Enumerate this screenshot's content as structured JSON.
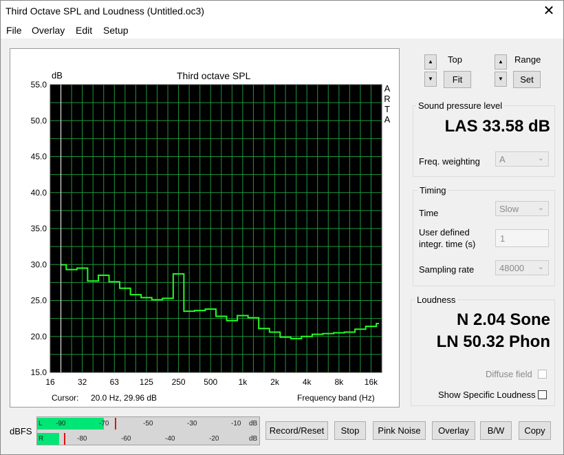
{
  "window": {
    "title": "Third Octave SPL and Loudness (Untitled.oc3)",
    "close": "✕"
  },
  "menu": [
    "File",
    "Overlay",
    "Edit",
    "Setup"
  ],
  "chart_data": {
    "type": "line",
    "title": "Third octave SPL",
    "ylabel": "dB",
    "xlabel": "Frequency band (Hz)",
    "ylim": [
      15.0,
      55.0
    ],
    "yticks": [
      "55.0",
      "50.0",
      "45.0",
      "40.0",
      "35.0",
      "30.0",
      "25.0",
      "20.0",
      "15.0"
    ],
    "xticks": [
      "16",
      "32",
      "63",
      "125",
      "250",
      "500",
      "1k",
      "2k",
      "4k",
      "8k",
      "16k"
    ],
    "bands": [
      "20",
      "25",
      "31.5",
      "40",
      "50",
      "63",
      "80",
      "100",
      "125",
      "160",
      "200",
      "250",
      "315",
      "400",
      "500",
      "630",
      "800",
      "1k",
      "1.25k",
      "1.6k",
      "2k",
      "2.5k",
      "3.15k",
      "4k",
      "5k",
      "6.3k",
      "8k",
      "10k",
      "12.5k",
      "16k",
      "20k"
    ],
    "values": [
      29.96,
      29.3,
      29.5,
      27.7,
      28.5,
      27.6,
      26.7,
      25.8,
      25.4,
      25.1,
      25.3,
      28.7,
      23.5,
      23.6,
      23.8,
      22.8,
      22.2,
      22.9,
      22.6,
      21.1,
      20.6,
      19.9,
      19.7,
      20.0,
      20.3,
      20.4,
      20.5,
      20.6,
      21.0,
      21.4,
      21.8
    ],
    "side_label": [
      "A",
      "R",
      "T",
      "A"
    ],
    "grid": true,
    "cursor": {
      "label": "Cursor:",
      "value": "20.0 Hz, 29.96 dB"
    }
  },
  "controls": {
    "top_label": "Top",
    "fit_label": "Fit",
    "range_label": "Range",
    "set_label": "Set",
    "spin_up": "▲",
    "spin_down": "▼"
  },
  "spl": {
    "group_label": "Sound pressure level",
    "value": "LAS 33.58 dB",
    "freq_weighting_label": "Freq. weighting",
    "freq_weighting_value": "A"
  },
  "timing": {
    "group_label": "Timing",
    "time_label": "Time",
    "time_value": "Slow",
    "user_time_label_1": "User defined",
    "user_time_label_2": "integr. time (s)",
    "user_time_value": "1",
    "sampling_label": "Sampling rate",
    "sampling_value": "48000"
  },
  "loudness": {
    "group_label": "Loudness",
    "sone": "N 2.04 Sone",
    "phon": "LN 50.32 Phon",
    "diffuse_label": "Diffuse field",
    "specific_label": "Show Specific Loudness"
  },
  "meter": {
    "label": "dBFS",
    "left_channel": "L",
    "right_channel": "R",
    "top_scale": [
      "-90",
      "-70",
      "-50",
      "-30",
      "-10",
      "dB"
    ],
    "bottom_scale": [
      "-80",
      "-60",
      "-40",
      "-20",
      "dB"
    ],
    "left_level_db": -70,
    "right_level_db": -90,
    "left_peak_db": -65,
    "right_peak_db": -88,
    "color_level": "#00e676",
    "color_peak": "#e01010"
  },
  "buttons": {
    "record_reset": "Record/Reset",
    "stop": "Stop",
    "pink_noise": "Pink Noise",
    "overlay": "Overlay",
    "bw": "B/W",
    "copy": "Copy"
  },
  "colors": {
    "plot_bg": "#000000",
    "grid": "#1e9a3c",
    "trace": "#22ff22",
    "cursor_line": "#ffffff"
  }
}
